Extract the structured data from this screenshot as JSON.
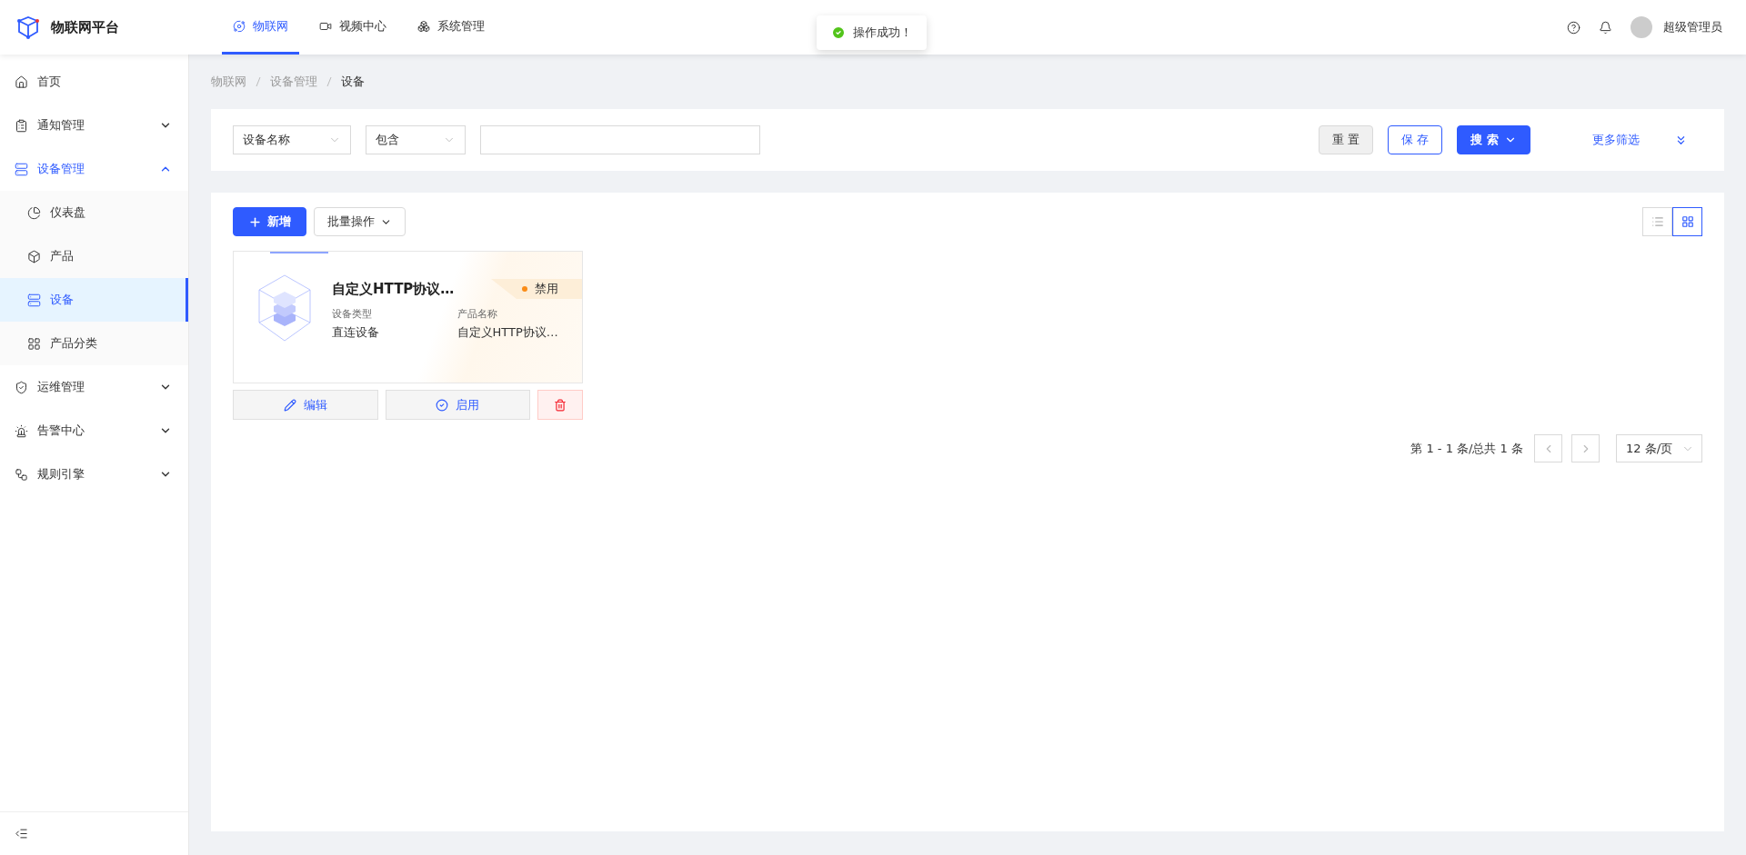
{
  "header": {
    "logo_text": "物联网平台",
    "nav": [
      {
        "label": "物联网",
        "selected": true
      },
      {
        "label": "视频中心",
        "selected": false
      },
      {
        "label": "系统管理",
        "selected": false
      }
    ],
    "user": "超级管理员"
  },
  "toast": {
    "message": "操作成功！",
    "kind": "success"
  },
  "sidebar": {
    "items": [
      {
        "label": "首页",
        "selected": false
      },
      {
        "label": "通知管理",
        "selected": false,
        "expanded": false
      },
      {
        "label": "设备管理",
        "selected": true,
        "expanded": true,
        "children": [
          {
            "label": "仪表盘",
            "selected": false
          },
          {
            "label": "产品",
            "selected": false
          },
          {
            "label": "设备",
            "selected": true
          },
          {
            "label": "产品分类",
            "selected": false
          }
        ]
      },
      {
        "label": "运维管理",
        "selected": false,
        "expanded": false
      },
      {
        "label": "告警中心",
        "selected": false,
        "expanded": false
      },
      {
        "label": "规则引擎",
        "selected": false,
        "expanded": false
      }
    ]
  },
  "breadcrumb": [
    "物联网",
    "设备管理",
    "设备"
  ],
  "filter": {
    "field": "设备名称",
    "operator": "包含",
    "buttons": [
      {
        "label": "重 置",
        "kind": "default"
      },
      {
        "label": "保 存",
        "kind": "outline"
      },
      {
        "label": "搜 索",
        "kind": "primary"
      }
    ],
    "more": "更多筛选"
  },
  "toolbar": {
    "add": "新增",
    "batch": "批量操作",
    "views": [
      {
        "kind": "list",
        "selected": false
      },
      {
        "kind": "grid",
        "selected": true
      }
    ]
  },
  "devices": [
    {
      "name": "自定义HTTP协议…",
      "status": "禁用",
      "color": "#fa8c16",
      "fields": [
        {
          "label": "设备类型",
          "value": "直连设备"
        },
        {
          "label": "产品名称",
          "value": "自定义HTTP协议…"
        }
      ],
      "actions": [
        {
          "kind": "edit",
          "label": "编辑"
        },
        {
          "kind": "enable",
          "label": "启用"
        },
        {
          "kind": "delete"
        }
      ]
    }
  ],
  "pagination": {
    "summary": "第 1 - 1 条/总共 1 条",
    "page_size": "12 条/页"
  }
}
